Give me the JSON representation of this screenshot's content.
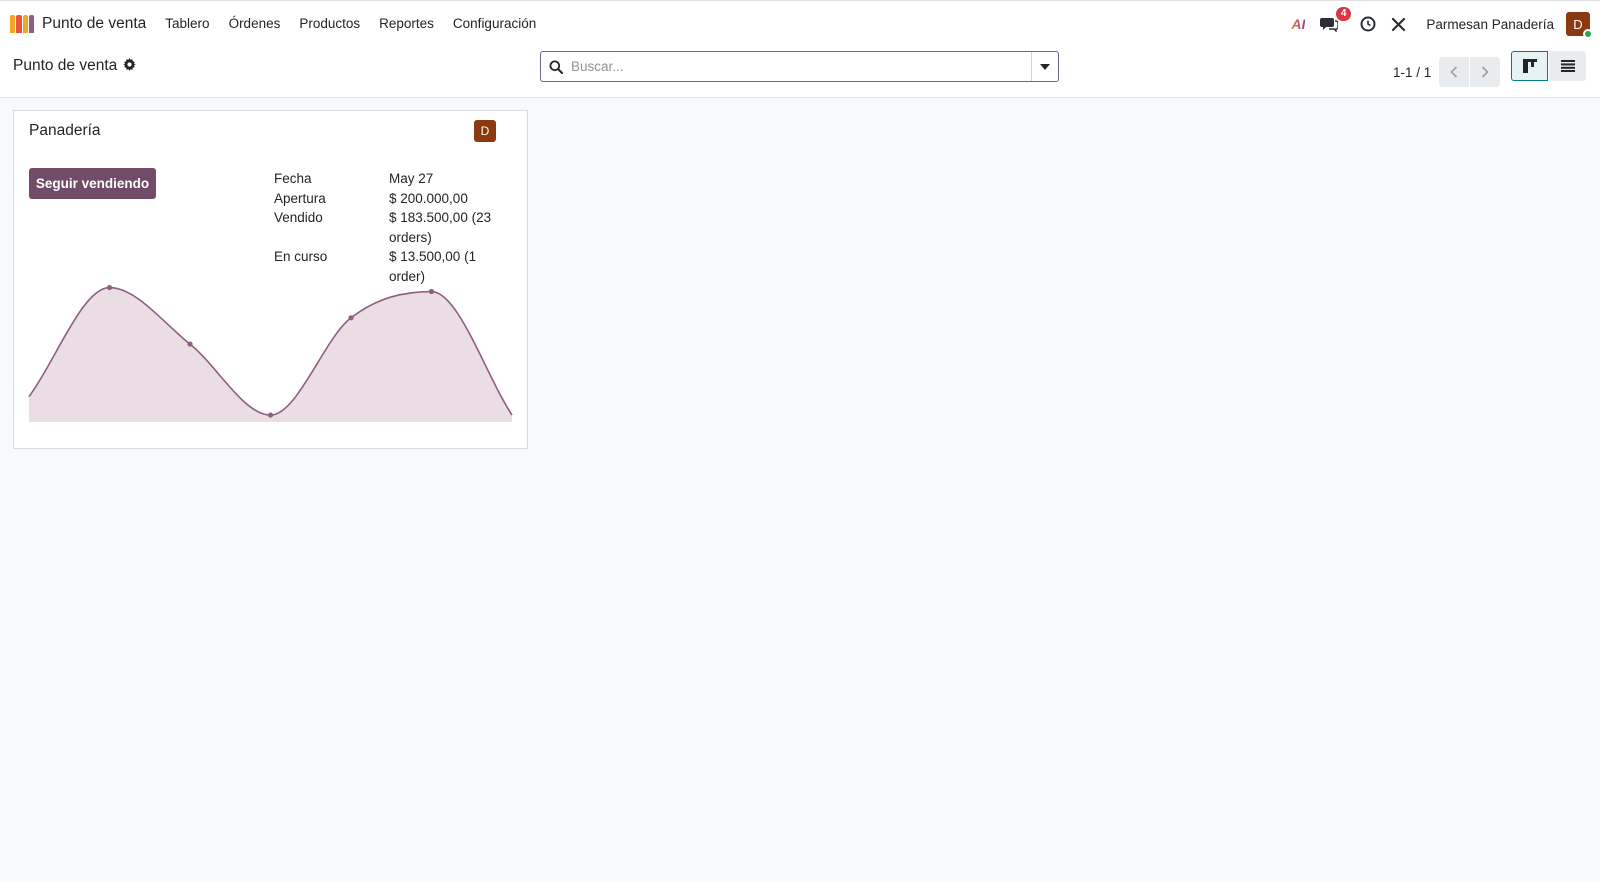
{
  "app": {
    "name": "Punto de venta"
  },
  "menu": [
    "Tablero",
    "Órdenes",
    "Productos",
    "Reportes",
    "Configuración"
  ],
  "systray": {
    "ai_label": "AI",
    "messages_badge": "4",
    "company": "Parmesan Panadería",
    "user_initial": "D"
  },
  "colors": {
    "accent": "#714b67",
    "avatar": "#8b3a0f",
    "badge": "#dc3545",
    "chart_line": "#8e5f82",
    "chart_fill": "#eadde4"
  },
  "breadcrumb": {
    "title": "Punto de venta"
  },
  "search": {
    "placeholder": "Buscar..."
  },
  "pager": {
    "value": "1-1 / 1"
  },
  "card": {
    "title": "Panadería",
    "avatar_initial": "D",
    "button_label": "Seguir vendiendo",
    "rows": [
      {
        "label": "Fecha",
        "value": "May 27"
      },
      {
        "label": "Apertura",
        "value": "$ 200.000,00"
      },
      {
        "label": "Vendido",
        "value": "$ 183.500,00 (23 orders)"
      },
      {
        "label": "En curso",
        "value": "$ 13.500,00 (1 order)"
      }
    ]
  },
  "chart_data": {
    "type": "area",
    "x": [
      0,
      1,
      2,
      3,
      4,
      5,
      6
    ],
    "values": [
      0.17,
      1.0,
      0.57,
      0.03,
      0.77,
      0.97,
      0.03
    ],
    "ylim": [
      0,
      1.05
    ],
    "grid": false
  }
}
